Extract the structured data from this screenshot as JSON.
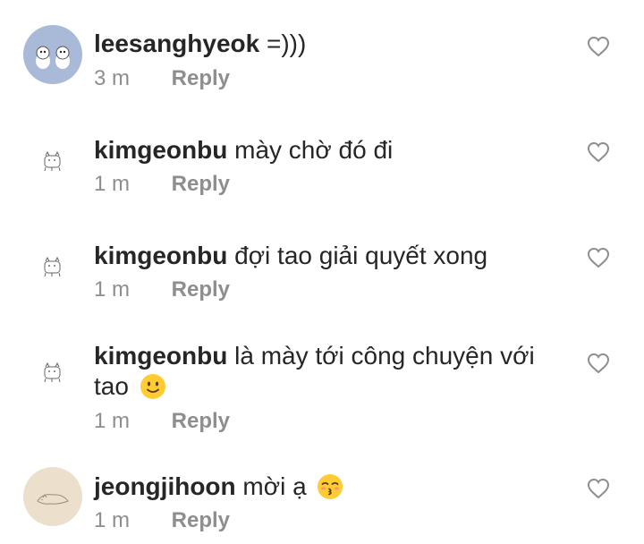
{
  "comments": [
    {
      "username": "leesanghyeok",
      "text": "=)))",
      "time": "3 m",
      "reply_label": "Reply",
      "avatar_icon": "penguin-avatar-icon"
    },
    {
      "username": "kimgeonbu",
      "text": "mày chờ đó đi",
      "time": "1 m",
      "reply_label": "Reply",
      "avatar_icon": "sketch-cat-avatar-icon"
    },
    {
      "username": "kimgeonbu",
      "text": "đợi tao giải quyết xong",
      "time": "1 m",
      "reply_label": "Reply",
      "avatar_icon": "sketch-cat-avatar-icon"
    },
    {
      "username": "kimgeonbu",
      "text": "là mày tới công chuyện với tao",
      "time": "1 m",
      "reply_label": "Reply",
      "avatar_icon": "sketch-cat-avatar-icon",
      "emoji": "slightly-smiling-face"
    },
    {
      "username": "jeongjihoon",
      "text": "mời ạ",
      "time": "1 m",
      "reply_label": "Reply",
      "avatar_icon": "sleeping-animal-avatar-icon",
      "emoji": "kissing-face-closed-eyes"
    }
  ],
  "colors": {
    "text": "#262626",
    "meta": "#8e8e8e",
    "avatar1_bg": "#a9b9d8",
    "avatar5_bg": "#ece0cc",
    "emoji_yellow": "#ffcc33"
  }
}
